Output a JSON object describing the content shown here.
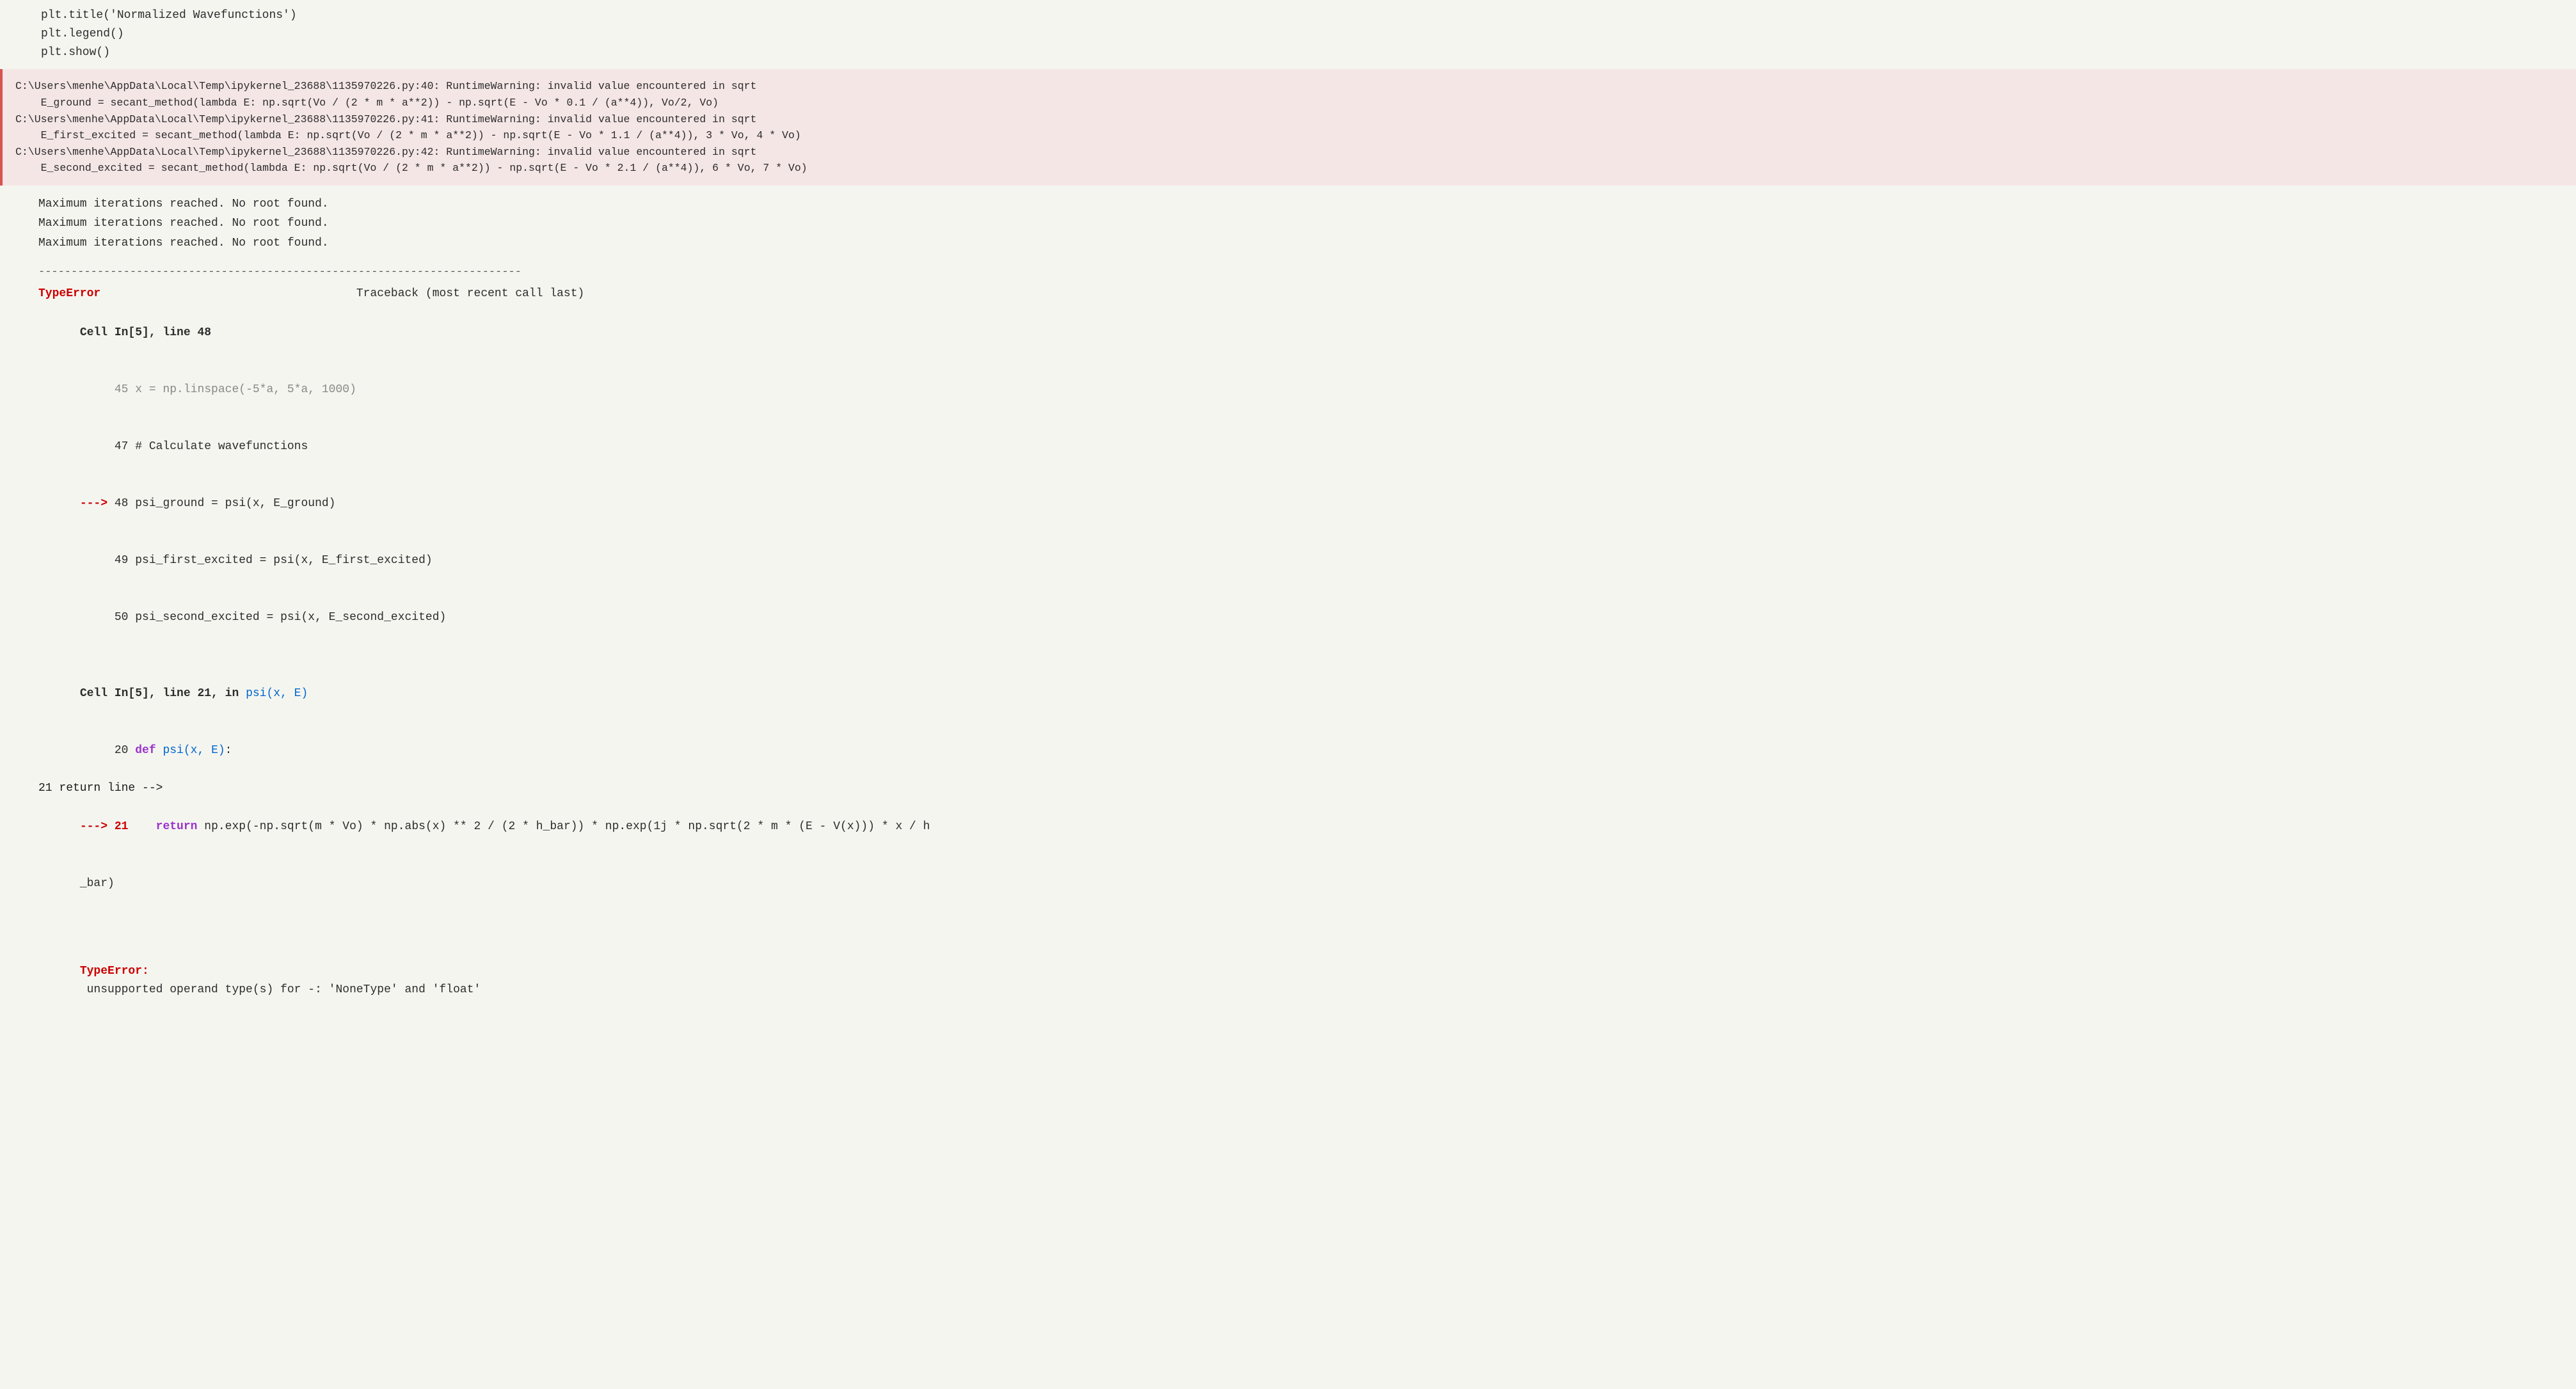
{
  "code_section": {
    "lines": [
      "plt.title('Normalized Wavefunctions')",
      "plt.legend()",
      "plt.show()"
    ]
  },
  "warning_section": {
    "lines": [
      "C:\\Users\\menhe\\AppData\\Local\\Temp\\ipykernel_23688\\1135970226.py:40: RuntimeWarning: invalid value encountered in sqrt",
      "    E_ground = secant_method(lambda E: np.sqrt(Vo / (2 * m * a**2)) - np.sqrt(E - Vo * 0.1 / (a**4)), Vo/2, Vo)",
      "C:\\Users\\menhe\\AppData\\Local\\Temp\\ipykernel_23688\\1135970226.py:41: RuntimeWarning: invalid value encountered in sqrt",
      "    E_first_excited = secant_method(lambda E: np.sqrt(Vo / (2 * m * a**2)) - np.sqrt(E - Vo * 1.1 / (a**4)), 3 * Vo, 4 * Vo)",
      "C:\\Users\\menhe\\AppData\\Local\\Temp\\ipykernel_23688\\1135970226.py:42: RuntimeWarning: invalid value encountered in sqrt",
      "    E_second_excited = secant_method(lambda E: np.sqrt(Vo / (2 * m * a**2)) - np.sqrt(E - Vo * 2.1 / (a**4)), 6 * Vo, 7 * Vo)"
    ]
  },
  "message_section": {
    "lines": [
      "Maximum iterations reached. No root found.",
      "Maximum iterations reached. No root found.",
      "Maximum iterations reached. No root found."
    ]
  },
  "divider_section": {
    "line": "--------------------------------------------------------------------------"
  },
  "traceback_section": {
    "error_label": "TypeError",
    "traceback_title": "                                     Traceback (most recent call last)",
    "cell_line": "Cell In[5], line 48",
    "lines": [
      "     45 x = np.linspace(-5*a, 5*a, 1000)",
      "     47 # Calculate wavefunctions",
      "---> 48 psi_ground = psi(x, E_ground)",
      "     49 psi_first_excited = psi(x, E_first_excited)",
      "     50 psi_second_excited = psi(x, E_second_excited)"
    ]
  },
  "traceback_cell2": {
    "cell_line": "Cell In[5], line 21, in ",
    "psi_label": "psi(x, E)",
    "lines": [
      "     20 def psi(x, E):",
      "---> 21     return np.exp(-np.sqrt(m * Vo) * np.abs(x) ** 2 / (2 * h_bar)) * np.exp(1j * np.sqrt(2 * m * (E - V(x))) * x / h",
      "_bar)"
    ]
  },
  "error_final": {
    "label": "TypeError:",
    "message": " unsupported operand type(s) for -: 'NoneType' and 'float'"
  }
}
